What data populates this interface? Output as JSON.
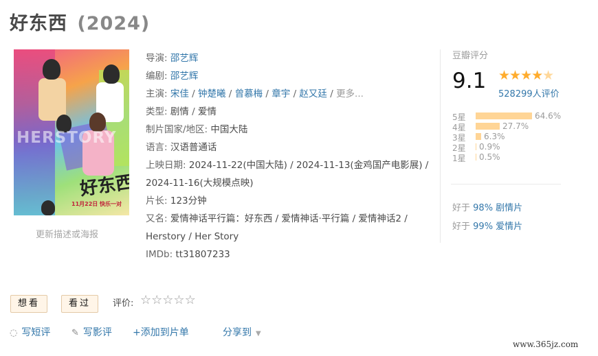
{
  "header": {
    "title": "好东西",
    "year": "(2024)"
  },
  "poster": {
    "english_title": "HERSTORY",
    "chinese_title": "好东西",
    "release_text": "11月22日 快乐一对",
    "update_link": "更新描述或海报"
  },
  "info": {
    "director": {
      "label": "导演:",
      "names": [
        "邵艺辉"
      ]
    },
    "writer": {
      "label": "编剧:",
      "names": [
        "邵艺辉"
      ]
    },
    "cast": {
      "label": "主演:",
      "names": [
        "宋佳",
        "钟楚曦",
        "曾慕梅",
        "章宇",
        "赵又廷"
      ],
      "more": "更多..."
    },
    "genre": {
      "label": "类型:",
      "values": [
        "剧情",
        "爱情"
      ]
    },
    "country": {
      "label": "制片国家/地区:",
      "value": "中国大陆"
    },
    "language": {
      "label": "语言:",
      "value": "汉语普通话"
    },
    "release": {
      "label": "上映日期:",
      "value": "2024-11-22(中国大陆) / 2024-11-13(金鸡国产电影展) / 2024-11-16(大规模点映)"
    },
    "runtime": {
      "label": "片长:",
      "value": "123分钟"
    },
    "aka": {
      "label": "又名:",
      "value": "爱情神话平行篇：好东西 / 爱情神话·平行篇 / 爱情神话2 / Herstory / Her Story"
    },
    "imdb": {
      "label": "IMDb:",
      "value": "tt31807233"
    }
  },
  "rating": {
    "title": "豆瓣评分",
    "score": "9.1",
    "stars_value": 4.5,
    "votes": "528299人评价",
    "distribution": [
      {
        "label": "5星",
        "percent": "64.6%",
        "value": 64.6
      },
      {
        "label": "4星",
        "percent": "27.7%",
        "value": 27.7
      },
      {
        "label": "3星",
        "percent": "6.3%",
        "value": 6.3
      },
      {
        "label": "2星",
        "percent": "0.9%",
        "value": 0.9
      },
      {
        "label": "1星",
        "percent": "0.5%",
        "value": 0.5
      }
    ],
    "better_than": [
      {
        "prefix": "好于",
        "link": "98% 剧情片"
      },
      {
        "prefix": "好于",
        "link": "99% 爱情片"
      }
    ]
  },
  "actions": {
    "want_label": "想看",
    "seen_label": "看过",
    "rate_label": "评价:",
    "short_review": "写短评",
    "long_review": "写影评",
    "add_list": "+添加到片单",
    "share": "分享到"
  },
  "watermark": "www.365jz.com",
  "colors": {
    "link": "#3377aa",
    "star": "#ffac2d",
    "bar": "#ffd596",
    "button_bg": "#fff5e8"
  }
}
